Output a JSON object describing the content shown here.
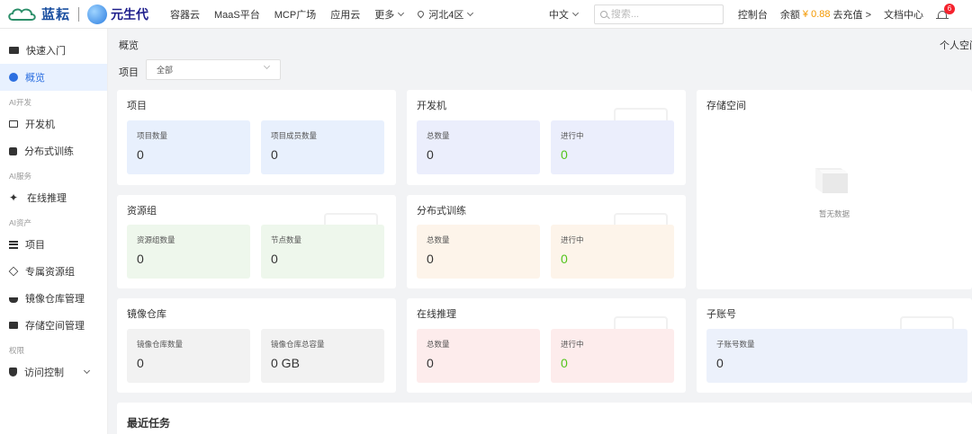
{
  "topbar": {
    "logo_primary": "蓝耘",
    "logo_secondary": "元生代",
    "nav": [
      "容器云",
      "MaaS平台",
      "MCP广场",
      "应用云"
    ],
    "more_label": "更多",
    "region": "河北4区",
    "language": "中文",
    "search_placeholder": "搜索...",
    "console_label": "控制台",
    "balance_label": "余额",
    "balance_amount": "¥ 0.88",
    "recharge_label": "去充值 >",
    "docs_label": "文档中心",
    "notification_count": "6"
  },
  "sidebar": {
    "quick_start": "快速入门",
    "overview": "概览",
    "group_ai_dev": "AI开发",
    "dev_machine": "开发机",
    "distributed_training": "分布式训练",
    "group_ai_service": "AI服务",
    "online_inference": "在线推理",
    "group_ai_assets": "AI资产",
    "project": "项目",
    "dedicated_resource_group": "专属资源组",
    "image_repo": "镜像仓库管理",
    "storage": "存储空间管理",
    "group_permission": "权限",
    "access_control": "访问控制"
  },
  "main": {
    "breadcrumb": "概览",
    "personal_space": "个人空间",
    "filter_label": "项目",
    "filter_value": "全部",
    "cards": {
      "project": {
        "title": "项目",
        "s1_label": "项目数量",
        "s1_value": "0",
        "s2_label": "项目成员数量",
        "s2_value": "0"
      },
      "devmachine": {
        "title": "开发机",
        "s1_label": "总数量",
        "s1_value": "0",
        "s2_label": "进行中",
        "s2_value": "0"
      },
      "resource_group": {
        "title": "资源组",
        "s1_label": "资源组数量",
        "s1_value": "0",
        "s2_label": "节点数量",
        "s2_value": "0"
      },
      "training": {
        "title": "分布式训练",
        "s1_label": "总数量",
        "s1_value": "0",
        "s2_label": "进行中",
        "s2_value": "0"
      },
      "image_repo": {
        "title": "镜像仓库",
        "s1_label": "镜像仓库数量",
        "s1_value": "0",
        "s2_label": "镜像仓库总容量",
        "s2_value": "0 GB"
      },
      "inference": {
        "title": "在线推理",
        "s1_label": "总数量",
        "s1_value": "0",
        "s2_label": "进行中",
        "s2_value": "0"
      },
      "storage": {
        "title": "存储空间",
        "empty_text": "暂无数据"
      },
      "subaccount": {
        "title": "子账号",
        "s1_label": "子账号数量",
        "s1_value": "0"
      }
    },
    "recent_tasks_title": "最近任务"
  },
  "colors": {
    "accent": "#2c6fe0",
    "balance": "#f39800",
    "running_value": "#52c41a",
    "badge": "#f5222d"
  },
  "icons": {
    "quick_start": "book-icon",
    "overview": "gauge-icon",
    "dev_machine": "monitor-icon",
    "training": "chip-icon",
    "inference": "sparkle-icon",
    "project": "list-icon",
    "resource_group": "layers-icon",
    "image_repo": "docker-icon",
    "storage": "folder-icon",
    "access_control": "shield-icon",
    "search": "search-icon",
    "notifications": "bell-icon"
  }
}
